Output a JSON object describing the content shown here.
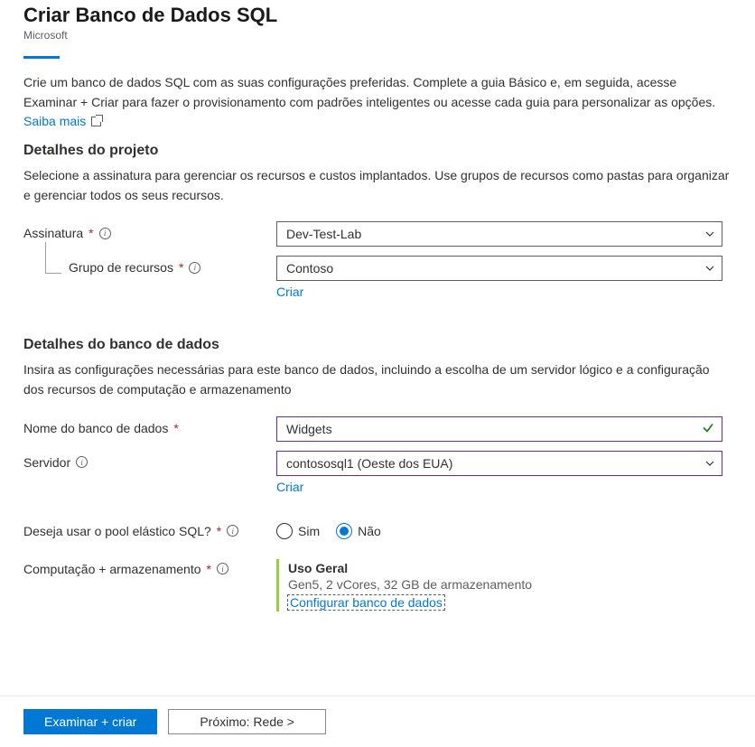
{
  "header": {
    "title": "Criar Banco de Dados SQL",
    "subtitle": "Microsoft"
  },
  "intro": {
    "text": "Crie um banco de dados SQL com as suas configurações preferidas. Complete a guia Básico e, em seguida, acesse Examinar + Criar para fazer o provisionamento com padrões inteligentes ou acesse cada guia para personalizar as opções. ",
    "learn_more": "Saiba mais"
  },
  "project": {
    "title": "Detalhes do projeto",
    "desc": "Selecione a assinatura para gerenciar os recursos e custos implantados. Use grupos de recursos como pastas para organizar e gerenciar todos os seus recursos.",
    "subscription_label": "Assinatura",
    "subscription_value": "Dev-Test-Lab",
    "resource_group_label": "Grupo de recursos",
    "resource_group_value": "Contoso",
    "create_new": "Criar"
  },
  "db": {
    "title": "Detalhes do banco de dados",
    "desc": "Insira as configurações necessárias para este banco de dados, incluindo a escolha de um servidor lógico e a configuração dos recursos de computação e armazenamento",
    "name_label": "Nome do banco de dados",
    "name_value": "Widgets",
    "server_label": "Servidor",
    "server_value": "contososql1 (Oeste dos EUA)",
    "create_new": "Criar",
    "pool_label": "Deseja usar o pool elástico SQL?",
    "pool_yes": "Sim",
    "pool_no": "Não",
    "compute_label": "Computação + armazenamento",
    "compute_title": "Uso Geral",
    "compute_spec": "Gen5, 2 vCores, 32 GB de armazenamento",
    "compute_link": "Configurar banco de dados"
  },
  "footer": {
    "review": "Examinar + criar",
    "next": "Próximo: Rede >"
  }
}
